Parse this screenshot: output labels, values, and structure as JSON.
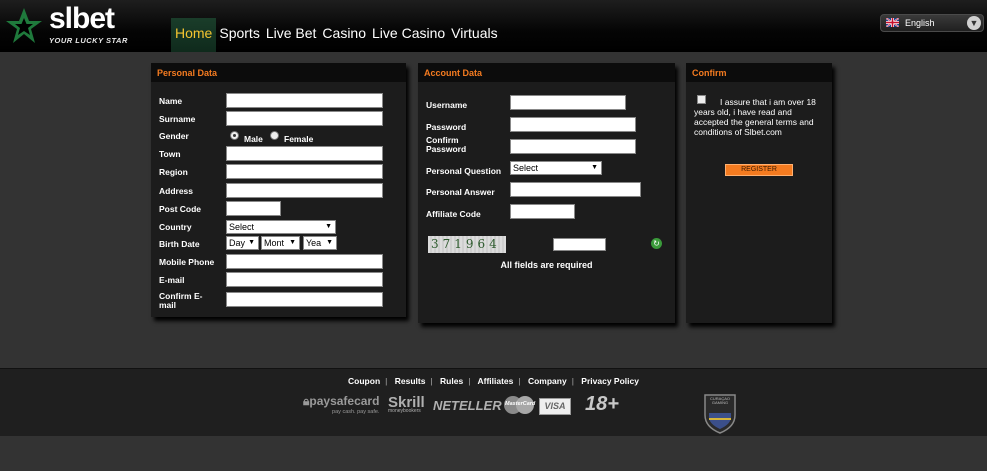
{
  "header": {
    "logo_text": "slbet",
    "logo_tagline": "YOUR LUCKY STAR",
    "nav": [
      "Home",
      "Sports",
      "Live Bet",
      "Casino",
      "Live Casino",
      "Virtuals"
    ],
    "language": "English"
  },
  "personal": {
    "title": "Personal Data",
    "name": "Name",
    "surname": "Surname",
    "gender": "Gender",
    "male": "Male",
    "female": "Female",
    "town": "Town",
    "region": "Region",
    "address": "Address",
    "post_code": "Post Code",
    "country": "Country",
    "country_select": "Select",
    "birth_date": "Birth Date",
    "day": "Day",
    "month": "Mont",
    "year": "Yea",
    "mobile": "Mobile Phone",
    "email": "E-mail",
    "confirm_email": "Confirm E-mail"
  },
  "account": {
    "title": "Account Data",
    "username": "Username",
    "password": "Password",
    "confirm_password": "Confirm Password",
    "question": "Personal Question",
    "question_select": "Select",
    "answer": "Personal Answer",
    "affiliate": "Affiliate Code",
    "captcha": "371964",
    "required": "All fields are required"
  },
  "confirm": {
    "title": "Confirm",
    "text": "I assure that i am over 18 years old, i have read and accepted the general terms and conditions of Slbet.com",
    "register": "REGISTER"
  },
  "footer": {
    "links": [
      "Coupon",
      "Results",
      "Rules",
      "Affiliates",
      "Company",
      "Privacy Policy"
    ],
    "paysafe": "paysafecard",
    "paysafe_sub": "pay cash. pay safe.",
    "skrill": "Skrill",
    "skrill_sub": "moneybookers",
    "neteller": "NETELLER",
    "mastercard": "MasterCard",
    "visa": "VISA",
    "age": "18+",
    "curacao": "CURAÇAO GAMING"
  }
}
